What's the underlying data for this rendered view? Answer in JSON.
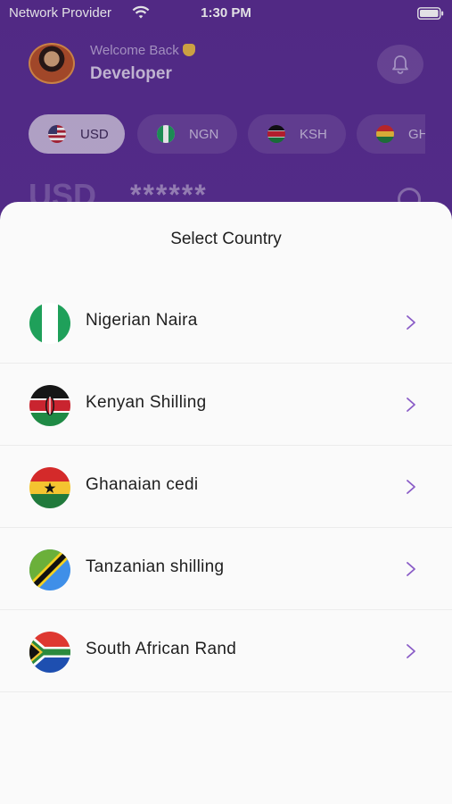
{
  "status_bar": {
    "provider": "Network Provider",
    "time": "1:30 PM"
  },
  "header": {
    "welcome": "Welcome Back",
    "username": "Developer"
  },
  "currencies": [
    {
      "code": "USD",
      "active": true
    },
    {
      "code": "NGN",
      "active": false
    },
    {
      "code": "KSH",
      "active": false
    },
    {
      "code": "GH",
      "active": false
    }
  ],
  "balance": {
    "currency": "USD",
    "masked": "******"
  },
  "sheet": {
    "title": "Select Country",
    "countries": [
      {
        "name": "Nigerian Naira",
        "flag": "nigeria-flag"
      },
      {
        "name": "Kenyan Shilling",
        "flag": "kenya-flag"
      },
      {
        "name": "Ghanaian cedi",
        "flag": "ghana-flag"
      },
      {
        "name": "Tanzanian shilling",
        "flag": "tanzania-flag"
      },
      {
        "name": "South African Rand",
        "flag": "south-africa-flag"
      }
    ]
  },
  "colors": {
    "brand_purple": "#5b2f8f",
    "chevron": "#8a5cc7",
    "sheet_bg": "#fafafa"
  }
}
